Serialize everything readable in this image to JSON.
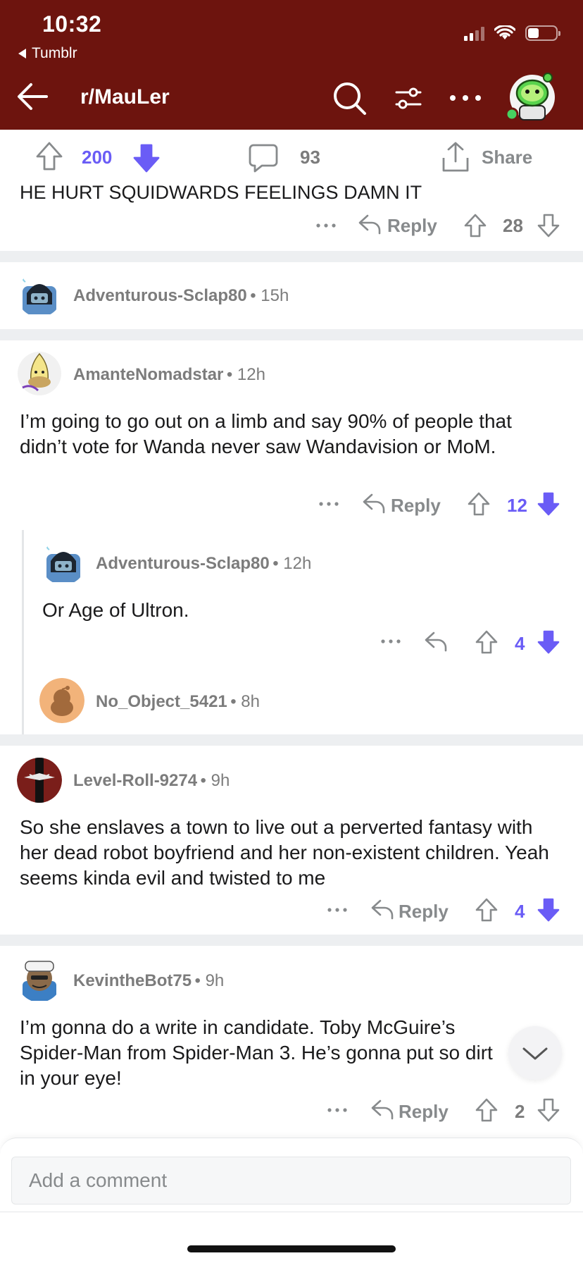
{
  "status_bar": {
    "time": "10:32",
    "back_app": "Tumblr"
  },
  "nav": {
    "title": "r/MauLer"
  },
  "post_actions": {
    "upvotes": "200",
    "comments": "93",
    "share_label": "Share"
  },
  "comments": [
    {
      "body": "HE HURT SQUIDWARDS FEELINGS DAMN IT",
      "reply_label": "Reply",
      "score": "28"
    },
    {
      "username": "Adventurous-Sclap80",
      "time": "15h"
    },
    {
      "username": "AmanteNomadstar",
      "time": "12h",
      "body": "I’m going to go out on a limb and say 90% of people that didn’t vote for Wanda never saw Wandavision or MoM.",
      "reply_label": "Reply",
      "score": "12"
    },
    {
      "username": "Adventurous-Sclap80",
      "time": "12h",
      "body": "Or Age of Ultron.",
      "score": "4"
    },
    {
      "username": "No_Object_5421",
      "time": "8h"
    },
    {
      "username": "Level-Roll-9274",
      "time": "9h",
      "body": "So she enslaves a town to live out a perverted fantasy with her dead robot boyfriend and her non-existent children. Yeah seems kinda evil and twisted to me",
      "reply_label": "Reply",
      "score": "4"
    },
    {
      "username": "KevintheBot75",
      "time": "9h",
      "body": "I’m gonna do a write in candidate. Toby McGuire’s Spider-Man from Spider-Man 3. He’s gonna put so dirt in your eye!",
      "reply_label": "Reply",
      "score": "2"
    }
  ],
  "composer": {
    "placeholder": "Add a comment"
  },
  "colors": {
    "header": "#6d140e",
    "accent": "#6a5cf6",
    "muted": "#7c7c7c"
  },
  "icons": [
    "chevron-back-icon",
    "search-icon",
    "filter-icon",
    "more-icon",
    "upvote-icon",
    "downvote-icon",
    "comment-icon",
    "share-icon",
    "reply-icon",
    "chevron-down-icon"
  ]
}
